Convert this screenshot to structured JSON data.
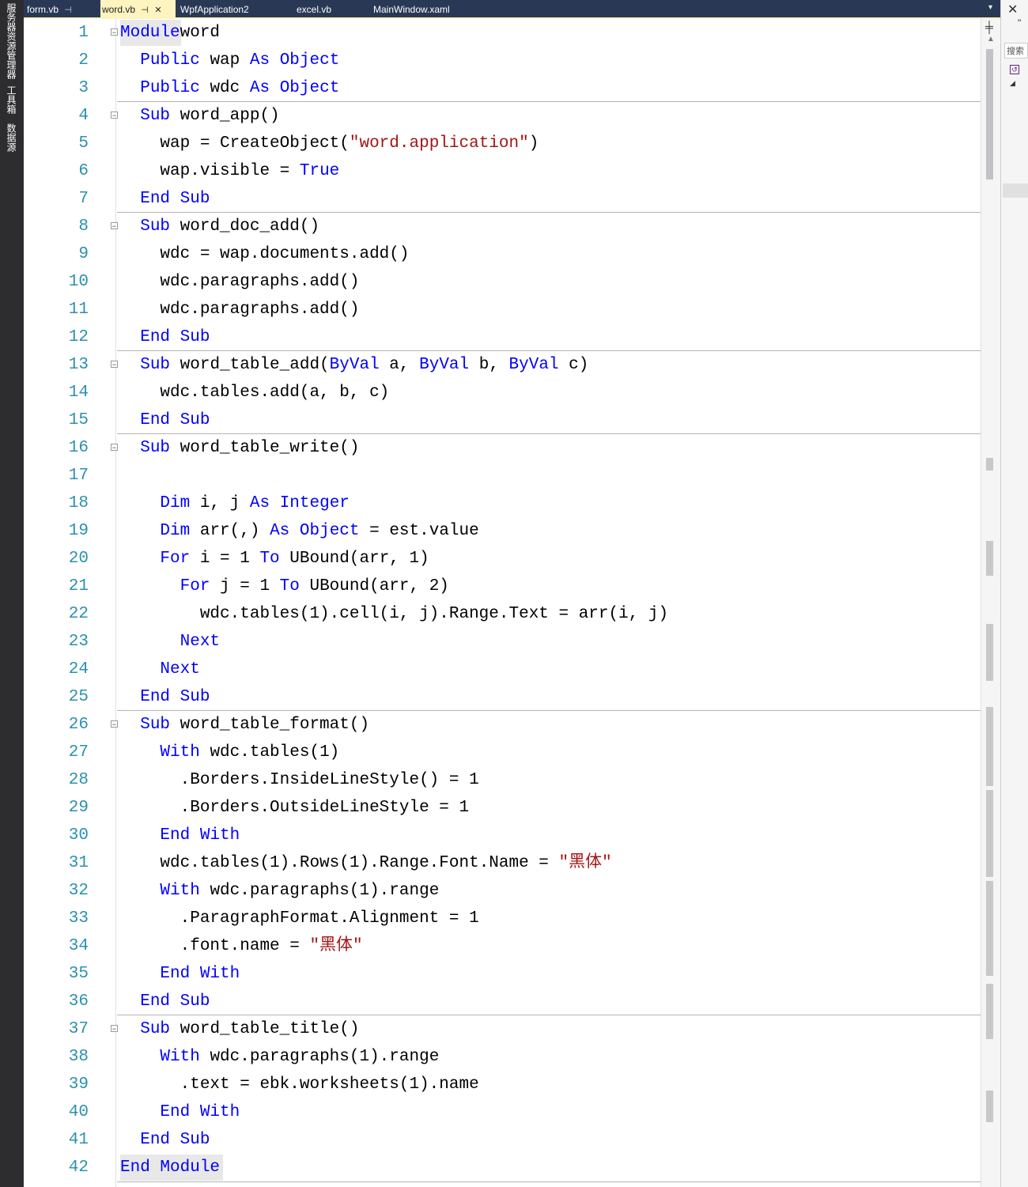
{
  "side_panel": {
    "tabs": [
      "服务器资源管理器",
      "工具箱",
      "数据源"
    ]
  },
  "tabs": [
    {
      "label": "form.vb",
      "pin": "⊣",
      "close": "",
      "active": false
    },
    {
      "label": "word.vb",
      "pin": "⊣",
      "close": "✕",
      "active": true
    },
    {
      "label": "WpfApplication2",
      "pin": "",
      "close": "",
      "active": false
    },
    {
      "label": "excel.vb",
      "pin": "",
      "close": "",
      "active": false
    },
    {
      "label": "MainWindow.xaml",
      "pin": "",
      "close": "",
      "active": false
    }
  ],
  "tab_dropdown": "▾",
  "right_panel": {
    "search_placeholder": "搜索",
    "close": "✕",
    "more": "\""
  },
  "code": {
    "lines": [
      {
        "n": "1",
        "fold": true,
        "indent": "",
        "tokens": [
          [
            "kw",
            "Module"
          ],
          [
            "",
            "word"
          ]
        ]
      },
      {
        "n": "2",
        "fold": false,
        "indent": "  ",
        "tokens": [
          [
            "kw",
            "Public"
          ],
          [
            "",
            " wap "
          ],
          [
            "kw",
            "As"
          ],
          [
            "",
            " "
          ],
          [
            "kw",
            "Object"
          ]
        ]
      },
      {
        "n": "3",
        "fold": false,
        "indent": "  ",
        "tokens": [
          [
            "kw",
            "Public"
          ],
          [
            "",
            " wdc "
          ],
          [
            "kw",
            "As"
          ],
          [
            "",
            " "
          ],
          [
            "kw",
            "Object"
          ]
        ]
      },
      {
        "n": "4",
        "fold": true,
        "indent": "  ",
        "tokens": [
          [
            "kw",
            "Sub"
          ],
          [
            "",
            " word_app()"
          ]
        ]
      },
      {
        "n": "5",
        "fold": false,
        "indent": "    ",
        "tokens": [
          [
            "",
            "wap = CreateObject("
          ],
          [
            "st",
            "\"word.application\""
          ],
          [
            "",
            ")"
          ]
        ]
      },
      {
        "n": "6",
        "fold": false,
        "indent": "    ",
        "tokens": [
          [
            "",
            "wap.visible = "
          ],
          [
            "kw",
            "True"
          ]
        ]
      },
      {
        "n": "7",
        "fold": false,
        "indent": "  ",
        "tokens": [
          [
            "kw",
            "End Sub"
          ]
        ]
      },
      {
        "n": "8",
        "fold": true,
        "indent": "  ",
        "tokens": [
          [
            "kw",
            "Sub"
          ],
          [
            "",
            " word_doc_add()"
          ]
        ]
      },
      {
        "n": "9",
        "fold": false,
        "indent": "    ",
        "tokens": [
          [
            "",
            "wdc = wap.documents.add()"
          ]
        ]
      },
      {
        "n": "10",
        "fold": false,
        "indent": "    ",
        "tokens": [
          [
            "",
            "wdc.paragraphs.add()"
          ]
        ]
      },
      {
        "n": "11",
        "fold": false,
        "indent": "    ",
        "tokens": [
          [
            "",
            "wdc.paragraphs.add()"
          ]
        ]
      },
      {
        "n": "12",
        "fold": false,
        "indent": "  ",
        "tokens": [
          [
            "kw",
            "End Sub"
          ]
        ]
      },
      {
        "n": "13",
        "fold": true,
        "indent": "  ",
        "tokens": [
          [
            "kw",
            "Sub"
          ],
          [
            "",
            " word_table_add("
          ],
          [
            "kw",
            "ByVal"
          ],
          [
            "",
            " a, "
          ],
          [
            "kw",
            "ByVal"
          ],
          [
            "",
            " b, "
          ],
          [
            "kw",
            "ByVal"
          ],
          [
            "",
            " c)"
          ]
        ]
      },
      {
        "n": "14",
        "fold": false,
        "indent": "    ",
        "tokens": [
          [
            "",
            "wdc.tables.add(a, b, c)"
          ]
        ]
      },
      {
        "n": "15",
        "fold": false,
        "indent": "  ",
        "tokens": [
          [
            "kw",
            "End Sub"
          ]
        ]
      },
      {
        "n": "16",
        "fold": true,
        "indent": "  ",
        "tokens": [
          [
            "kw",
            "Sub"
          ],
          [
            "",
            " word_table_write()"
          ]
        ]
      },
      {
        "n": "17",
        "fold": false,
        "indent": "",
        "tokens": []
      },
      {
        "n": "18",
        "fold": false,
        "indent": "    ",
        "tokens": [
          [
            "kw",
            "Dim"
          ],
          [
            "",
            " i, j "
          ],
          [
            "kw",
            "As"
          ],
          [
            "",
            " "
          ],
          [
            "kw",
            "Integer"
          ]
        ]
      },
      {
        "n": "19",
        "fold": false,
        "indent": "    ",
        "tokens": [
          [
            "kw",
            "Dim"
          ],
          [
            "",
            " arr(,) "
          ],
          [
            "kw",
            "As"
          ],
          [
            "",
            " "
          ],
          [
            "kw",
            "Object"
          ],
          [
            "",
            " = est.value"
          ]
        ]
      },
      {
        "n": "20",
        "fold": false,
        "indent": "    ",
        "tokens": [
          [
            "kw",
            "For"
          ],
          [
            "",
            " i = 1 "
          ],
          [
            "kw",
            "To"
          ],
          [
            "",
            " UBound(arr, 1)"
          ]
        ]
      },
      {
        "n": "21",
        "fold": false,
        "indent": "      ",
        "tokens": [
          [
            "kw",
            "For"
          ],
          [
            "",
            " j = 1 "
          ],
          [
            "kw",
            "To"
          ],
          [
            "",
            " UBound(arr, 2)"
          ]
        ]
      },
      {
        "n": "22",
        "fold": false,
        "indent": "        ",
        "tokens": [
          [
            "",
            "wdc.tables(1).cell(i, j).Range.Text = arr(i, j)"
          ]
        ]
      },
      {
        "n": "23",
        "fold": false,
        "indent": "      ",
        "tokens": [
          [
            "kw",
            "Next"
          ]
        ]
      },
      {
        "n": "24",
        "fold": false,
        "indent": "    ",
        "tokens": [
          [
            "kw",
            "Next"
          ]
        ]
      },
      {
        "n": "25",
        "fold": false,
        "indent": "  ",
        "tokens": [
          [
            "kw",
            "End Sub"
          ]
        ]
      },
      {
        "n": "26",
        "fold": true,
        "indent": "  ",
        "tokens": [
          [
            "kw",
            "Sub"
          ],
          [
            "",
            " word_table_format()"
          ]
        ]
      },
      {
        "n": "27",
        "fold": false,
        "indent": "    ",
        "tokens": [
          [
            "kw",
            "With"
          ],
          [
            "",
            " wdc.tables(1)"
          ]
        ]
      },
      {
        "n": "28",
        "fold": false,
        "indent": "      ",
        "tokens": [
          [
            "",
            ".Borders.InsideLineStyle() = 1"
          ]
        ]
      },
      {
        "n": "29",
        "fold": false,
        "indent": "      ",
        "tokens": [
          [
            "",
            ".Borders.OutsideLineStyle = 1"
          ]
        ]
      },
      {
        "n": "30",
        "fold": false,
        "indent": "    ",
        "tokens": [
          [
            "kw",
            "End With"
          ]
        ]
      },
      {
        "n": "31",
        "fold": false,
        "indent": "    ",
        "tokens": [
          [
            "",
            "wdc.tables(1).Rows(1).Range.Font.Name = "
          ],
          [
            "st",
            "\"黑体\""
          ]
        ]
      },
      {
        "n": "32",
        "fold": false,
        "indent": "    ",
        "tokens": [
          [
            "kw",
            "With"
          ],
          [
            "",
            " wdc.paragraphs(1).range"
          ]
        ]
      },
      {
        "n": "33",
        "fold": false,
        "indent": "      ",
        "tokens": [
          [
            "",
            ".ParagraphFormat.Alignment = 1"
          ]
        ]
      },
      {
        "n": "34",
        "fold": false,
        "indent": "      ",
        "tokens": [
          [
            "",
            ".font.name = "
          ],
          [
            "st",
            "\"黑体\""
          ]
        ]
      },
      {
        "n": "35",
        "fold": false,
        "indent": "    ",
        "tokens": [
          [
            "kw",
            "End With"
          ]
        ]
      },
      {
        "n": "36",
        "fold": false,
        "indent": "  ",
        "tokens": [
          [
            "kw",
            "End Sub"
          ]
        ]
      },
      {
        "n": "37",
        "fold": true,
        "indent": "  ",
        "tokens": [
          [
            "kw",
            "Sub"
          ],
          [
            "",
            " word_table_title()"
          ]
        ]
      },
      {
        "n": "38",
        "fold": false,
        "indent": "    ",
        "tokens": [
          [
            "kw",
            "With"
          ],
          [
            "",
            " wdc.paragraphs(1).range"
          ]
        ]
      },
      {
        "n": "39",
        "fold": false,
        "indent": "      ",
        "tokens": [
          [
            "",
            ".text = ebk.worksheets(1).name"
          ]
        ]
      },
      {
        "n": "40",
        "fold": false,
        "indent": "    ",
        "tokens": [
          [
            "kw",
            "End With"
          ]
        ]
      },
      {
        "n": "41",
        "fold": false,
        "indent": "  ",
        "tokens": [
          [
            "kw",
            "End Sub"
          ]
        ]
      },
      {
        "n": "42",
        "fold": false,
        "indent": "",
        "tokens": [
          [
            "kw",
            "End Module"
          ]
        ]
      }
    ]
  },
  "icons": {
    "fold": "⊟",
    "split": "╪",
    "scroll_up": "▲",
    "reference": "↺",
    "expand": "◢"
  },
  "colors": {
    "keyword": "#0000ff",
    "string": "#a31515",
    "line_number": "#2b91af",
    "active_tab": "#fdf4bf",
    "tab_bar": "#293955"
  }
}
